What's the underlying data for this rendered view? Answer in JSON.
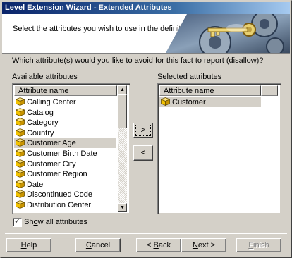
{
  "window": {
    "title": "Level Extension Wizard - Extended Attributes"
  },
  "header": {
    "instruction": "Select the attributes you wish to use in the definition"
  },
  "question": "Which attribute(s) would you like to avoid for this fact to report (disallow)?",
  "available": {
    "label_mnemonic": "A",
    "label_rest": "vailable attributes",
    "column_header": "Attribute name",
    "items": [
      "Calling Center",
      "Catalog",
      "Category",
      "Country",
      "Customer Age",
      "Customer Birth Date",
      "Customer City",
      "Customer Region",
      "Date",
      "Discontinued Code",
      "Distribution Center"
    ],
    "selected_item": "Customer Age"
  },
  "selected": {
    "label_mnemonic": "S",
    "label_rest": "elected attributes",
    "column_header": "Attribute name",
    "items": [
      "Customer"
    ]
  },
  "buttons": {
    "add": ">",
    "remove": "<",
    "help_mnemonic": "H",
    "help_rest": "elp",
    "cancel_mnemonic": "C",
    "cancel_rest": "ancel",
    "back_prefix": "< ",
    "back_mnemonic": "B",
    "back_rest": "ack",
    "next_mnemonic": "N",
    "next_rest": "ext >",
    "finish_mnemonic": "F",
    "finish_rest": "inish"
  },
  "show_all": {
    "label_pre": "Sh",
    "label_mnemonic": "o",
    "label_rest": "w all attributes",
    "checked": true,
    "mark": "✓"
  },
  "icons": {
    "list_item": "attribute-cube-icon",
    "scroll_up": "scroll-up-arrow-icon",
    "scroll_down": "scroll-down-arrow-icon",
    "banner": "key-and-gears-banner-art"
  },
  "colors": {
    "title_start": "#0a246a",
    "title_end": "#a6caf0",
    "face": "#d4d0c8",
    "cube_yellow": "#f2c200"
  }
}
